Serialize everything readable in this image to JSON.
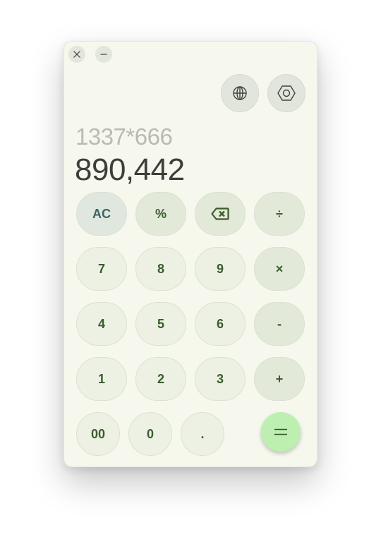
{
  "window": {
    "close_icon": "close-icon",
    "minimize_icon": "minimize-icon"
  },
  "toolbar": {
    "language_icon": "globe-icon",
    "settings_icon": "hexagon-settings-icon"
  },
  "display": {
    "expression": "1337*666",
    "result": "890,442"
  },
  "keys": {
    "ac": "AC",
    "percent": "%",
    "backspace_icon": "backspace-icon",
    "divide": "÷",
    "seven": "7",
    "eight": "8",
    "nine": "9",
    "multiply": "×",
    "four": "4",
    "five": "5",
    "six": "6",
    "minus": "-",
    "one": "1",
    "two": "2",
    "three": "3",
    "plus": "+",
    "double_zero": "00",
    "zero": "0",
    "decimal": ".",
    "equals_icon": "equals-icon"
  },
  "colors": {
    "window_bg": "#f6f8ee",
    "key_text": "#3a5d2c",
    "equals_bg": "#bcefb0"
  }
}
